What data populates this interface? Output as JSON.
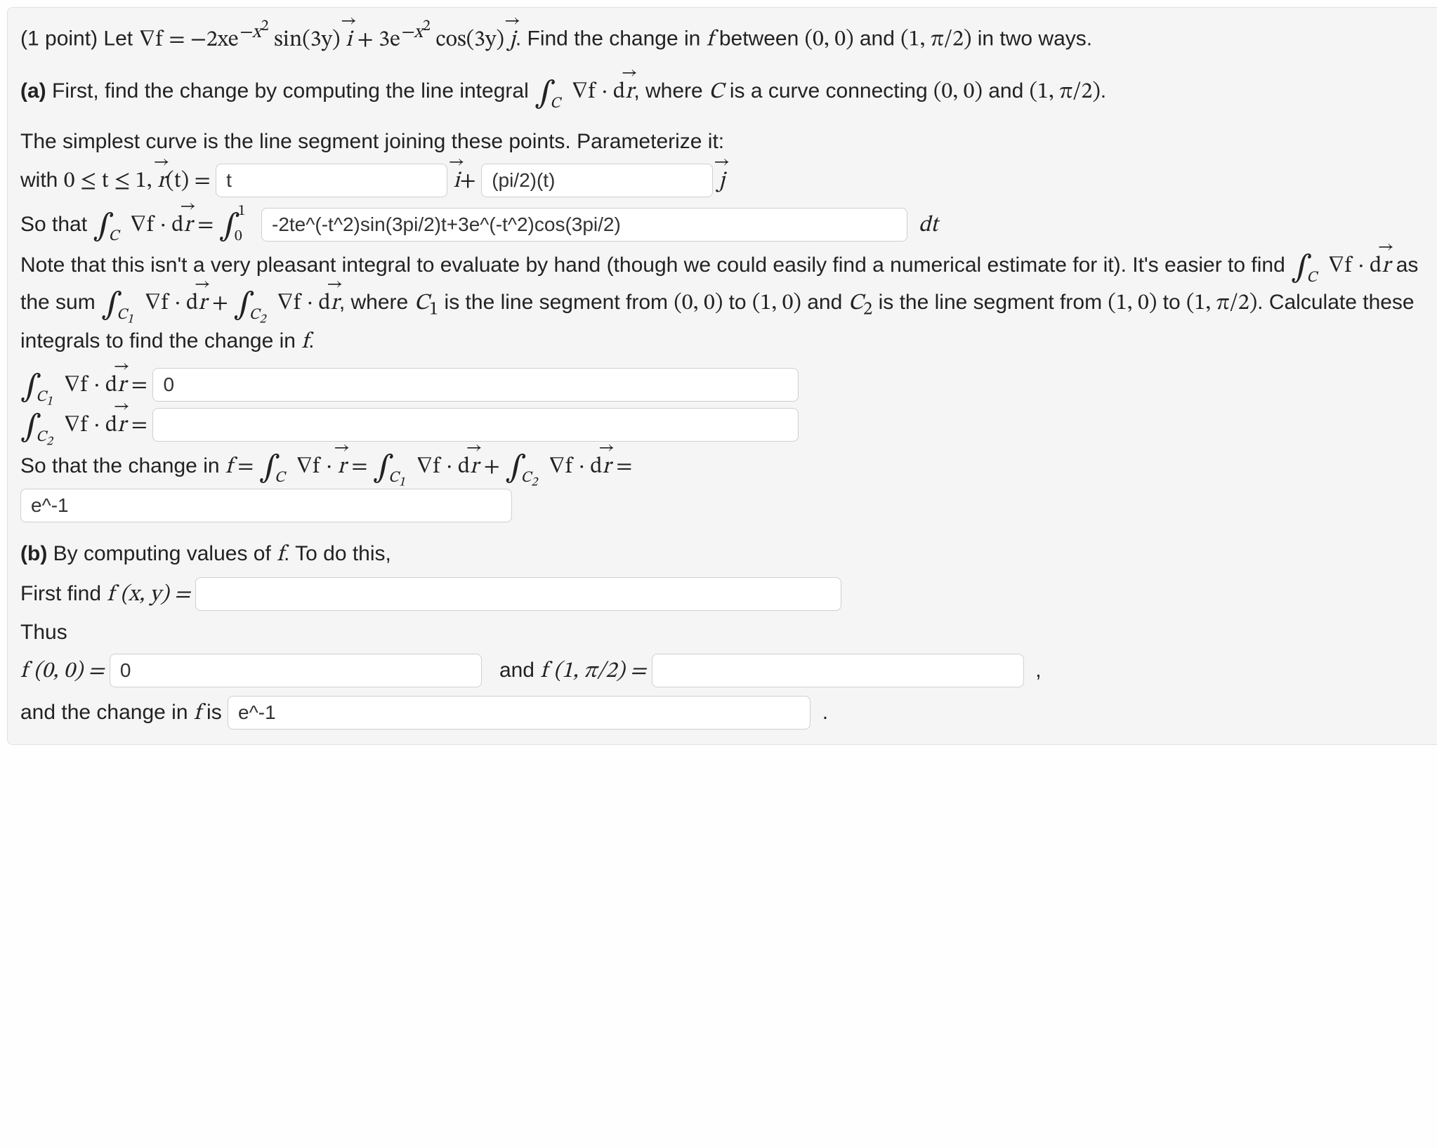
{
  "intro_prefix": "(1 point) Let ",
  "grad_f_eq": "∇f = −2xe",
  "exp1_sup": "−x",
  "exp1_sup2": "2",
  "sin_part": " sin(3y) ",
  "plus_3e": " + 3e",
  "cos_part": " cos(3y) ",
  "find_change": ". Find the change in ",
  "f_letter": "f",
  "between": " between ",
  "pt00": "(0, 0)",
  "and_word": " and ",
  "pt1pi2": "(1, π/2)",
  "two_ways": " in two ways.",
  "part_a_label": "(a)",
  "part_a_text1": " First, find the change by computing the line integral ",
  "where_C": ", where ",
  "C_letter": "C",
  "a_text2": " is a curve connecting ",
  "pt00b": "(0, 0)",
  "and2": " and ",
  "pt1pi2b": "(1, π/2)",
  "period": ".",
  "simplest": "The simplest curve is the line segment joining these points. Parameterize it:",
  "with_range": "with ",
  "range": "0 ≤ t ≤ 1, ",
  "r_of_t": "(t) = ",
  "i_plus": "+ ",
  "int_from0to1_pre": "So that ",
  "eq_sign": " = ",
  "integrand_value": "-2te^(-t^2)sin(3pi/2)t+3e^(-t^2)cos(3pi/2)",
  "dt": "dt",
  "note_line1": "Note that this isn't a very pleasant integral to evaluate by hand (though we could easily find a numerical estimate for it). It's easier to find ",
  "as_sum": " as the sum ",
  "where_C1": ", where ",
  "C1": "C",
  "c1_sub": "1",
  "is_seg1": " is the line segment from ",
  "to1": " to ",
  "pt10": "(1, 0)",
  "and3": " and ",
  "C2": "C",
  "c2_sub": "2",
  "is_seg2": " is the line segment from ",
  "to2": " to ",
  "calc_these": ". Calculate these integrals to find the change in ",
  "f_letter2": "f",
  "period2": ".",
  "so_change": "So that the change in ",
  "f_letter3": "f",
  "eq": " = ",
  "plus": " + ",
  "equals2": " = ",
  "part_b_label": "(b)",
  "part_b_text": " By computing values of ",
  "to_do_this": ". To do this,",
  "first_find": "First find ",
  "fxy": "f (x, y) = ",
  "thus": "Thus",
  "f00": "f (0, 0) = ",
  "and_f1": "and ",
  "f1pi2": "f (1, π/2) = ",
  "comma": ",",
  "change_is": "and the change in ",
  "is": " is ",
  "dot": ".",
  "dr": "d",
  "r": "r",
  "i": "i",
  "j": "j",
  "nabla_f": "∇f",
  "cdot": " · ",
  "int_sym": "∫",
  "zero": "0",
  "one": "1",
  "inputs": {
    "r_i": "t",
    "r_j": "(pi/2)(t)",
    "c1_int": "0",
    "c2_int": "",
    "change_sum": "e^-1",
    "fxy_val": "",
    "f00_val": "0",
    "f1pi2_val": "",
    "change_final": "e^-1"
  }
}
